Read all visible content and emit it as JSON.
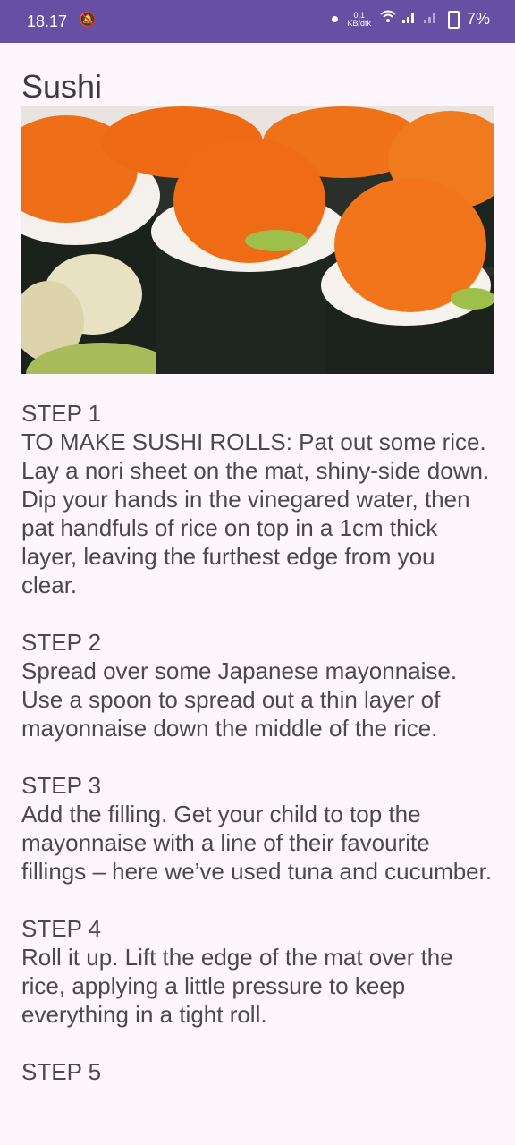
{
  "status_bar": {
    "time": "18.17",
    "net_speed_top": "0,1",
    "net_speed_bottom": "KB/dtk",
    "battery": "7%"
  },
  "title": "Sushi",
  "steps": [
    {
      "title": "STEP 1",
      "text": "TO MAKE SUSHI ROLLS: Pat out some rice. Lay a nori sheet on the mat, shiny-side down. Dip your hands in the vinegared water, then pat handfuls of rice on top in a 1cm thick layer, leaving the furthest edge from you clear."
    },
    {
      "title": "STEP 2",
      "text": "Spread over some Japanese mayonnaise. Use a spoon to spread out a thin layer of mayonnaise down the middle of the rice."
    },
    {
      "title": "STEP 3",
      "text": "Add the filling. Get your child to top the mayonnaise with a line of their favourite fillings – here we’ve used tuna and cucumber."
    },
    {
      "title": "STEP 4",
      "text": "Roll it up. Lift the edge of the mat over the rice, applying a little pressure to keep everything in a tight roll."
    },
    {
      "title": "STEP 5",
      "text": ""
    }
  ]
}
